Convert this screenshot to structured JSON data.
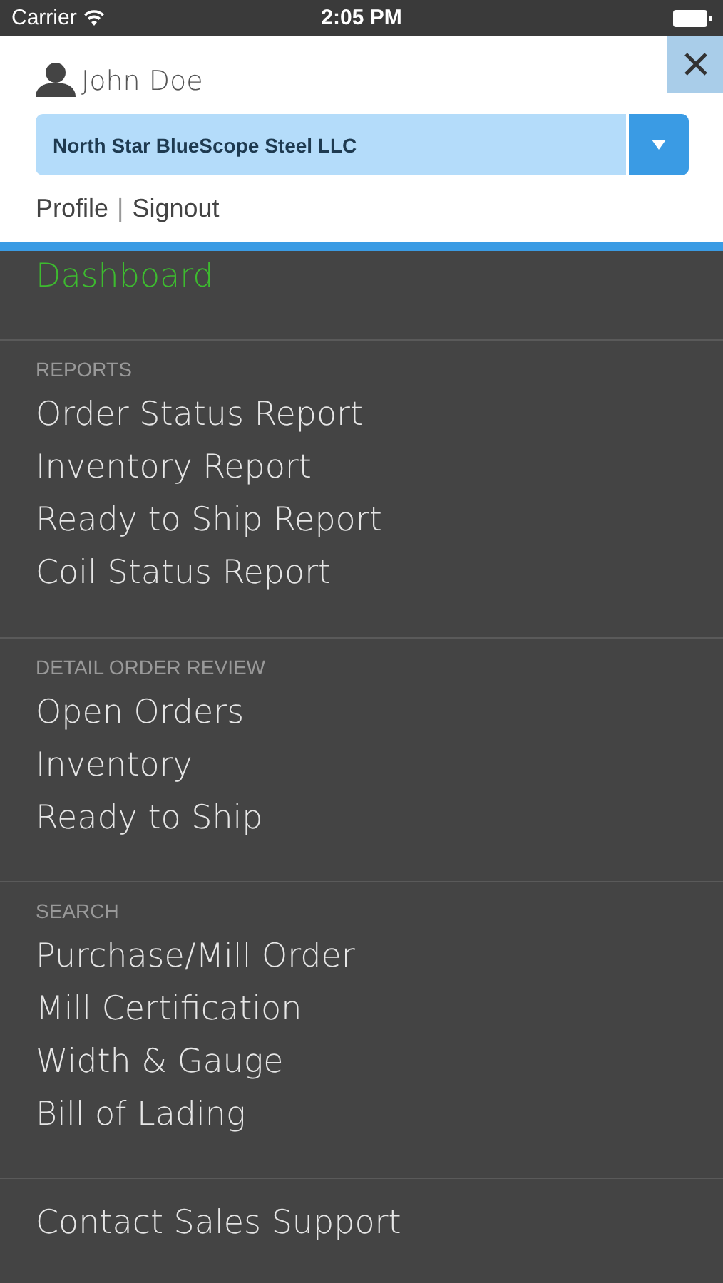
{
  "status_bar": {
    "carrier": "Carrier",
    "time": "2:05 PM"
  },
  "header": {
    "user_name": "John Doe",
    "company": "North Star BlueScope Steel LLC",
    "links": [
      "Profile",
      "Signout"
    ],
    "separator": "|"
  },
  "dashboard": {
    "label": "Dashboard",
    "selected": true
  },
  "sections": [
    {
      "heading": "REPORTS",
      "items": [
        {
          "label": "Order Status Report",
          "selected": false
        },
        {
          "label": "Inventory Report",
          "selected": false
        },
        {
          "label": "Ready to Ship Report",
          "selected": false
        },
        {
          "label": "Coil Status Report",
          "selected": false
        }
      ]
    },
    {
      "heading": "DETAIL ORDER REVIEW",
      "items": [
        {
          "label": "Open Orders",
          "selected": false
        },
        {
          "label": "Inventory",
          "selected": false
        },
        {
          "label": "Ready to Ship",
          "selected": false
        }
      ]
    },
    {
      "heading": "SEARCH",
      "items": [
        {
          "label": "Purchase/Mill Order",
          "selected": false
        },
        {
          "label": "Mill Certification",
          "selected": false
        },
        {
          "label": "Width & Gauge",
          "selected": false
        },
        {
          "label": "Bill of Lading",
          "selected": false
        }
      ]
    }
  ],
  "contact": {
    "label": "Contact Sales Support",
    "selected": false
  }
}
